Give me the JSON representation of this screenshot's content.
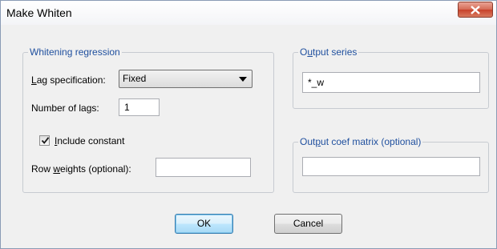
{
  "window": {
    "title": "Make Whiten"
  },
  "regression": {
    "legend": "Whitening regression",
    "lag_spec": {
      "label_first": "L",
      "label_rest": "ag specification:",
      "value": "Fixed"
    },
    "num_lags": {
      "label_pre": "Number of la",
      "label_ul": "g",
      "label_post": "s:",
      "value": "1"
    },
    "include_constant": {
      "label_ul": "I",
      "label_rest": "nclude constant",
      "checked": true
    },
    "row_weights": {
      "label_pre": "Row ",
      "label_ul": "w",
      "label_post": "eights (optional):",
      "value": ""
    }
  },
  "output_series": {
    "legend_pre": "O",
    "legend_ul": "u",
    "legend_post": "tput series",
    "value": "*_w"
  },
  "output_coef": {
    "legend_pre": "Out",
    "legend_ul": "p",
    "legend_post": "ut coef matrix (optional)",
    "value": ""
  },
  "buttons": {
    "ok": "OK",
    "cancel": "Cancel"
  }
}
